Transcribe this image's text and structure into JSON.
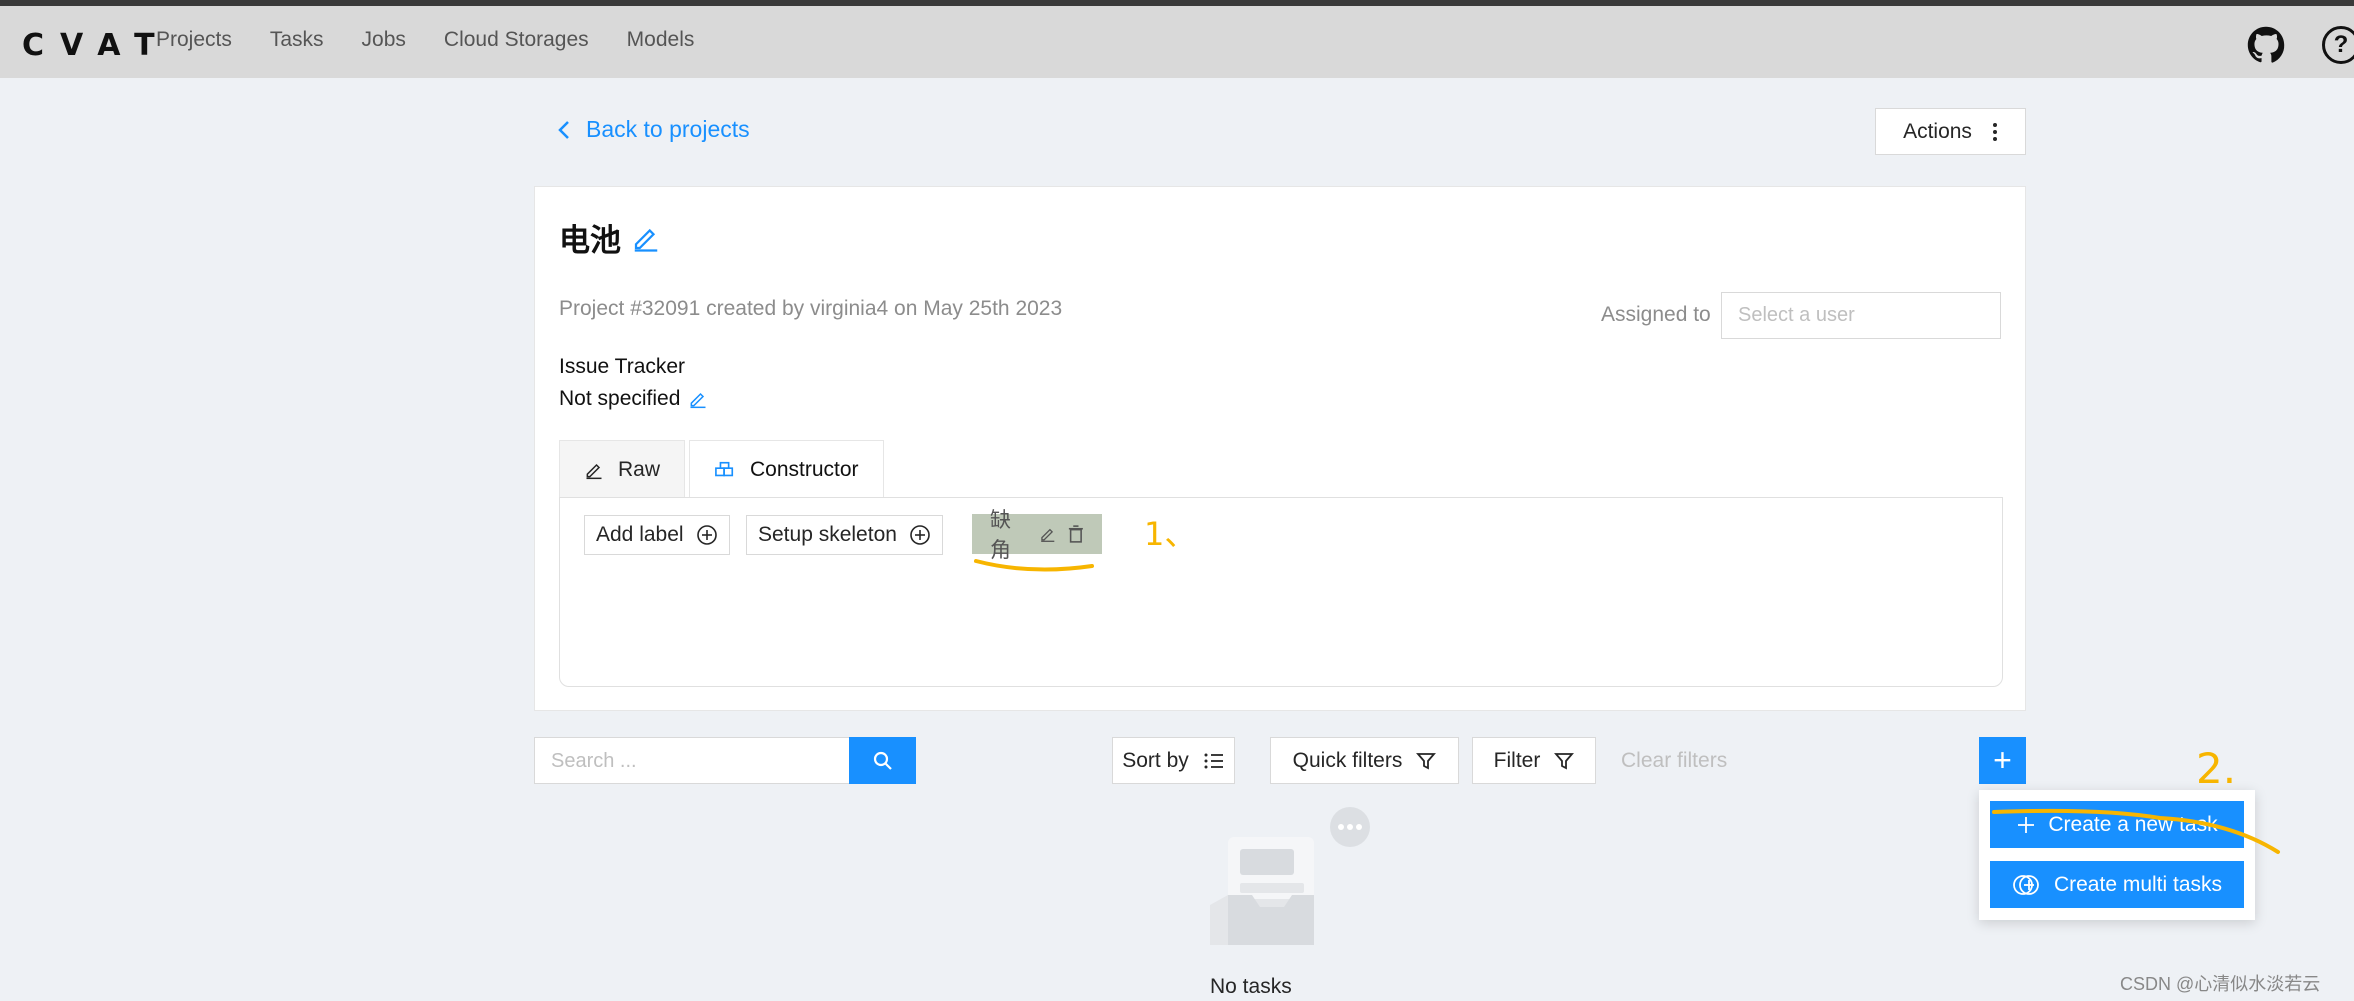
{
  "header": {
    "logo": "CVAT",
    "nav": [
      "Projects",
      "Tasks",
      "Jobs",
      "Cloud Storages",
      "Models"
    ],
    "help_icon": "?"
  },
  "page": {
    "back_label": "Back to projects",
    "actions_label": "Actions"
  },
  "project": {
    "title": "电池",
    "meta": "Project #32091 created by virginia4 on May 25th 2023",
    "assigned_label": "Assigned to",
    "assign_placeholder": "Select a user",
    "issue_tracker_label": "Issue Tracker",
    "issue_tracker_value": "Not specified"
  },
  "tabs": [
    {
      "label": "Raw",
      "icon": "edit-icon",
      "active": false
    },
    {
      "label": "Constructor",
      "icon": "build-icon",
      "active": true
    }
  ],
  "constructor": {
    "add_label": "Add label",
    "setup_skeleton": "Setup skeleton",
    "labels": [
      {
        "name": "缺角",
        "color": "#bfc9b8"
      }
    ]
  },
  "toolbar": {
    "search_placeholder": "Search ...",
    "sort_by": "Sort by",
    "quick_filters": "Quick filters",
    "filter": "Filter",
    "clear_filters": "Clear filters",
    "plus": "+"
  },
  "create_menu": {
    "create_task": "Create a new task",
    "create_multi": "Create multi tasks"
  },
  "empty": {
    "text": "No tasks found"
  },
  "annotations": [
    "1、",
    "2."
  ],
  "watermark": "CSDN @心清似水淡若云",
  "colors": {
    "primary": "#1890ff",
    "header_bg": "#d9d9d9",
    "page_bg": "#eef1f5",
    "annotation": "#f7b500"
  }
}
